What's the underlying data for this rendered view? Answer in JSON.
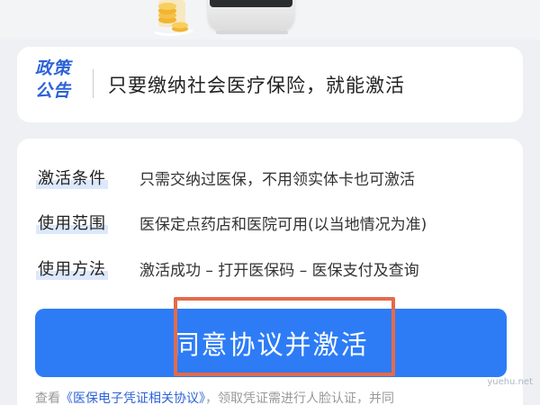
{
  "policy": {
    "tag_line1": "政策",
    "tag_line2": "公告",
    "text": "只要缴纳社会医疗保险，就能激活"
  },
  "info": {
    "rows": [
      {
        "label": "激活条件",
        "value": "只需交纳过医保，不用领实体卡也可激活"
      },
      {
        "label": "使用范围",
        "value": "医保定点药店和医院可用(以当地情况为准)"
      },
      {
        "label": "使用方法",
        "value": "激活成功 – 打开医保码 – 医保支付及查询"
      }
    ]
  },
  "activate_button": {
    "label": "同意协议并激活"
  },
  "agreement": {
    "prefix": "查看",
    "link": "《医保电子凭证相关协议》",
    "suffix": "，领取凭证需进行人脸认证，并同"
  },
  "watermark": "yuehu.net",
  "colors": {
    "accent": "#2d7cf6",
    "link": "#2d62d8",
    "highlight_border": "#e36b4b",
    "background": "#eef0f3"
  },
  "icons": [
    "coin-jar-illustration",
    "card-reader-device-illustration"
  ]
}
